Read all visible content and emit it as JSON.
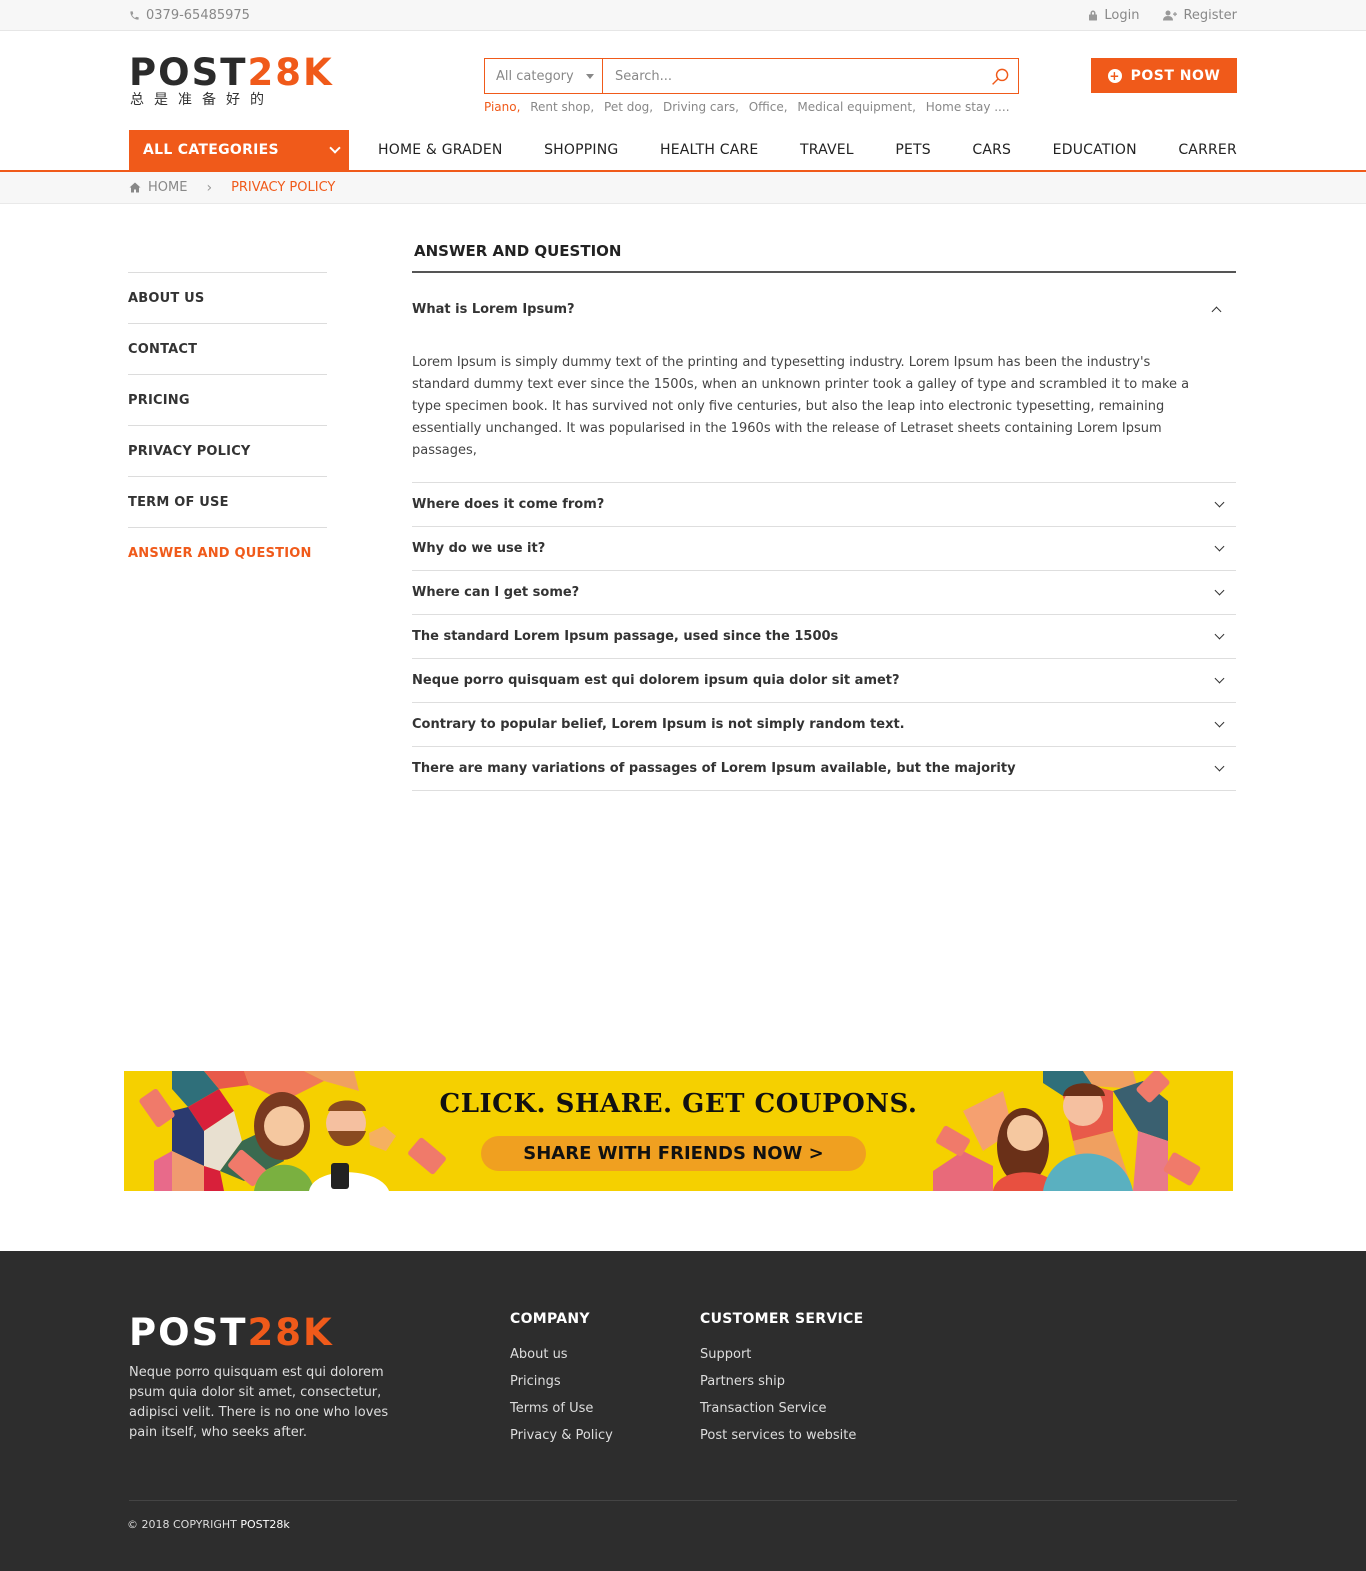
{
  "topbar": {
    "phone": "0379-65485975",
    "login": "Login",
    "register": "Register"
  },
  "header": {
    "logo_main": "POST",
    "logo_accent": "28K",
    "logo_sub": "总是准备好的",
    "search_category": "All category",
    "search_placeholder": "Search...",
    "tags": [
      "Piano,",
      "Rent shop,",
      "Pet dog,",
      "Driving cars,",
      "Office,",
      "Medical equipment,",
      "Home stay ...."
    ],
    "post_button": "POST NOW"
  },
  "nav": {
    "all_categories": "ALL CATEGORIES",
    "items": [
      "HOME & GRADEN",
      "SHOPPING",
      "HEALTH CARE",
      "TRAVEL",
      "PETS",
      "CARS",
      "EDUCATION",
      "CARRER"
    ]
  },
  "breadcrumb": {
    "home": "HOME",
    "current": "PRIVACY POLICY"
  },
  "sidebar": {
    "items": [
      "ABOUT US",
      "CONTACT",
      "PRICING",
      "PRIVACY POLICY",
      "TERM OF USE",
      "ANSWER AND QUESTION"
    ],
    "active_index": 5
  },
  "faq": {
    "title": "ANSWER AND QUESTION",
    "items": [
      {
        "question": "What is Lorem Ipsum?",
        "answer": "Lorem Ipsum is simply dummy text of the printing and typesetting industry. Lorem Ipsum has been the industry's standard dummy text ever since the 1500s, when an unknown printer took a galley of type and scrambled it to make a type specimen book. It has survived not only five centuries, but also the leap into electronic typesetting, remaining essentially unchanged. It was popularised in the 1960s with the release of Letraset sheets containing Lorem Ipsum passages,",
        "expanded": true
      },
      {
        "question": "Where does it come from?",
        "expanded": false
      },
      {
        "question": "Why do we use it?",
        "expanded": false
      },
      {
        "question": "Where can I get some?",
        "expanded": false
      },
      {
        "question": "The standard Lorem Ipsum passage, used since the 1500s",
        "expanded": false
      },
      {
        "question": "Neque porro quisquam est qui dolorem ipsum quia dolor sit amet?",
        "expanded": false
      },
      {
        "question": "Contrary to popular belief, Lorem Ipsum is not simply random text.",
        "expanded": false
      },
      {
        "question": "There are many variations of passages of Lorem Ipsum available, but the majority",
        "expanded": false
      }
    ]
  },
  "banner": {
    "headline": "CLICK. SHARE. GET COUPONS.",
    "button": "SHARE WITH FRIENDS NOW  >"
  },
  "footer": {
    "logo_main": "POST",
    "logo_accent": "28K",
    "description": "Neque porro quisquam est qui dolorem psum quia dolor sit amet, consectetur, adipisci velit. There is no one who loves pain itself, who seeks after.",
    "company": {
      "title": "COMPANY",
      "links": [
        "About us",
        "Pricings",
        "Terms of Use",
        "Privacy & Policy"
      ]
    },
    "customer_service": {
      "title": "CUSTOMER SERVICE",
      "links": [
        "Support",
        "Partners ship",
        "Transaction Service",
        "Post services to website"
      ]
    },
    "copyright": "© 2018 COPYRIGHT",
    "copyright_brand": "POST28k"
  },
  "colors": {
    "accent": "#f05a1a",
    "footer_bg": "#2d2d2d",
    "banner_bg": "#f5d000"
  }
}
